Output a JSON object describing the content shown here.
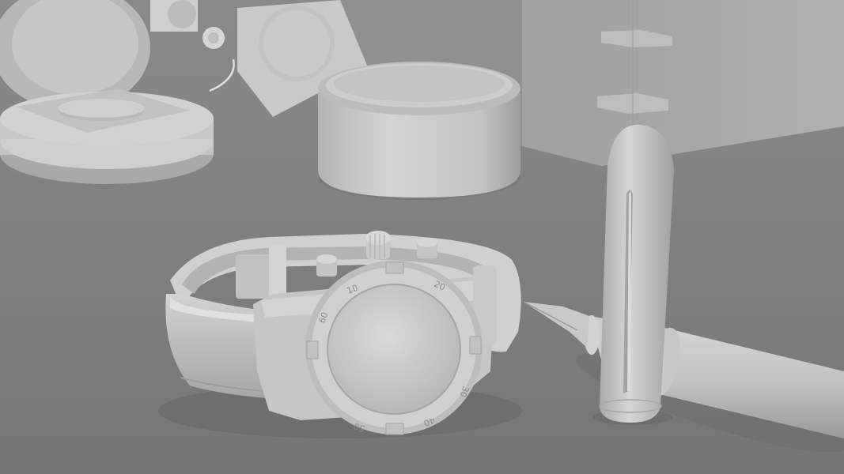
{
  "scene": {
    "description_type": "clay-render",
    "colors": {
      "background_floor": "#7d7d7d",
      "background_wall": "#8e8e8e",
      "box_wall": "#a8a8a8",
      "object_light": "#d8d8d8",
      "object_mid": "#bdbdbd",
      "object_dark": "#8f8f8f",
      "shadow": "#5f5f5f"
    },
    "bezel_numbers": [
      "10",
      "20",
      "30",
      "40",
      "50",
      "60"
    ]
  }
}
